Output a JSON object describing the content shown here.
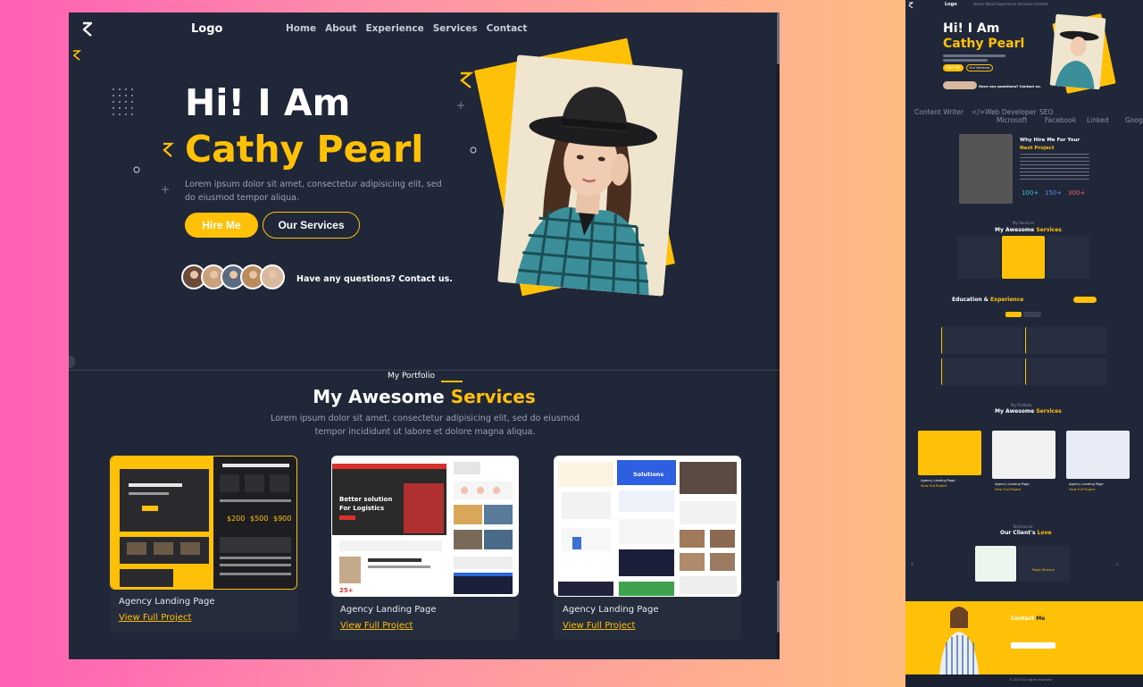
{
  "nav": {
    "logo": "Logo",
    "menu": [
      "Home",
      "About",
      "Experience",
      "Services",
      "Contact"
    ]
  },
  "hero": {
    "greeting": "Hi! I Am",
    "name": "Cathy Pearl",
    "text": "Lorem ipsum dolor sit amet, consectetur adipisicing elit, sed do eiusmod tempor aliqua.",
    "hire_button": "Hire Me",
    "services_button": "Our Services",
    "question": "Have any questions? Contact us."
  },
  "portfolio": {
    "kicker": "My Portfolio",
    "title_white": "My Awesome ",
    "title_yellow": "Services",
    "subtitle": "Lorem ipsum dolor sit amet, consectetur adipisicing elit, sed do eiusmod tempor incididunt ut labore et dolore magna aliqua.",
    "cards": [
      {
        "title": "Agency Landing Page",
        "link": "View Full Project"
      },
      {
        "title": "Agency Landing Page",
        "link": "View Full Project"
      },
      {
        "title": "Agency Landing Page",
        "link": "View Full Project"
      }
    ]
  },
  "preview": {
    "logo": "Logo",
    "greeting": "Hi! I Am",
    "name": "Cathy Pearl",
    "hire": "Hire Me",
    "services": "Our Services",
    "question": "Have any questions? Contact us.",
    "skills": [
      "Content Writer",
      "</>Web Developer",
      "SEO"
    ],
    "brands": [
      "Microsoft",
      "Facebook",
      "Linked",
      "Goog"
    ],
    "why_title": "Why Hire Me For Your",
    "why_yellow": "Next Project",
    "stats": [
      "100+",
      "150+",
      "300+"
    ],
    "services_kicker": "My Services",
    "services_title": "My Awesome",
    "services_yellow": "Services",
    "edu_title": "Education &",
    "edu_yellow": "Experience",
    "portfolio_kicker": "My Portfolio",
    "portfolio_title": "My Awesome",
    "portfolio_yellow": "Services",
    "card_title": "Agency Landing Page",
    "card_link": "View Full Project",
    "testimonial_kicker": "Testimonial",
    "testimonial_title": "Our Client's",
    "testimonial_yellow": "Love",
    "client_name": "Pooja Sharma",
    "contact_title": "Contact",
    "contact_yellow": "Me",
    "copyright": "© 2023 All rights reserved"
  },
  "colors": {
    "accent": "#ffc107",
    "background": "#202738",
    "card": "#252c3c"
  }
}
